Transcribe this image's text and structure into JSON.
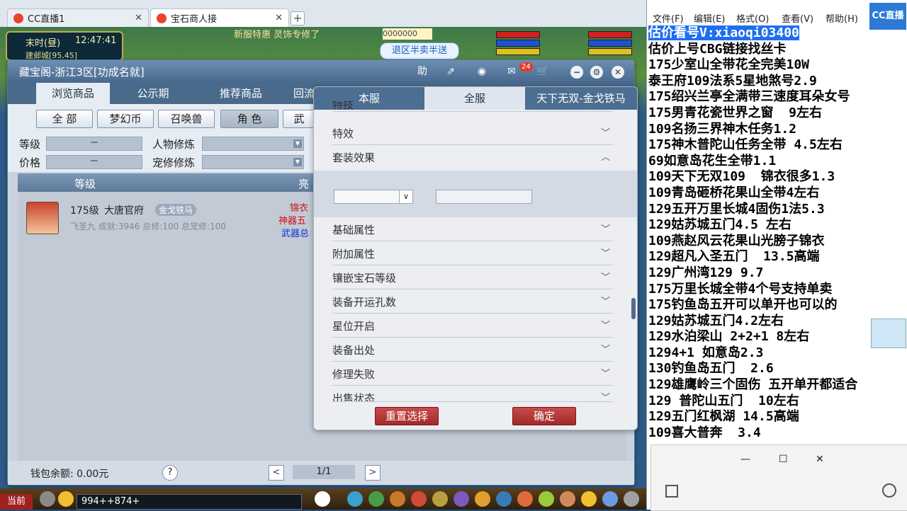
{
  "browser": {
    "tabs": [
      {
        "label": "CC直播1",
        "close": "✕"
      },
      {
        "label": "宝石商人接",
        "close": "✕"
      }
    ],
    "new_tab": "+"
  },
  "game_hud": {
    "time_period": "末时(昼)",
    "clock": "12:47:41",
    "location": "建邺城[95,45]",
    "news": "新服特惠  灵饰专修了",
    "coins": "0000000",
    "notice_button": "退区半卖半送"
  },
  "window": {
    "title": "藏宝阁-浙江3区[功成名就]",
    "title_buttons": {
      "help": "助",
      "share": "⇗",
      "record": "◉",
      "message_badge": "24",
      "cart": "🛒",
      "minimize": "−",
      "settings": "⚙",
      "close": "✕"
    },
    "main_tabs": [
      "浏览商品",
      "公示期",
      "推荐商品",
      "回流"
    ],
    "categories": [
      "全 部",
      "梦幻币",
      "召唤兽",
      "角 色",
      "武"
    ],
    "filters": {
      "level_label": "等级",
      "level_value": "－",
      "price_label": "价格",
      "price_value": "－",
      "role_cult_label": "人物修炼",
      "pet_cult_label": "宠修修炼"
    },
    "list_header": {
      "level": "等级",
      "bright": "亮"
    },
    "item": {
      "level": "175级",
      "school": "大唐官府",
      "tag": "金戈铁马",
      "stats": "飞圣九  成就:3946  总修:100  总宠修:100",
      "highlight1": "锦衣",
      "highlight2": "神器五",
      "highlight3": "武器总"
    },
    "footer": {
      "wallet": "钱包余额: 0.00元",
      "help": "?",
      "prev": "<",
      "page": "1/1",
      "next": ">"
    }
  },
  "panel": {
    "tabs": [
      "本服",
      "全服",
      "天下无双-金戈铁马"
    ],
    "partial_row": "特技",
    "rows": [
      "特效",
      "套装效果",
      "基础属性",
      "附加属性",
      "镶嵌宝石等级",
      "装备开运孔数",
      "星位开启",
      "装备出处",
      "修理失败",
      "出售状态"
    ],
    "chevron_down": "﹀",
    "chevron_up": "︿",
    "select_arrow": "∨",
    "reset_button": "重置选择",
    "confirm_button": "确定"
  },
  "game_bottom": {
    "current_label": "当前",
    "chat_input": "994++874+"
  },
  "notepad": {
    "menu": [
      "文件(F)",
      "编辑(E)",
      "格式(O)",
      "查看(V)",
      "帮助(H)"
    ],
    "lines": [
      "估价看号V:xiaoqi03400",
      "估价上号CBG链接找丝卡",
      "175少室山全带花全完美10W",
      "泰王府109法系5星地煞号2.9",
      "175绍兴兰亭全满带三速度耳朵女号",
      "175男青花瓷世界之窗  9左右",
      "109名扬三界神木任务1.2",
      "175神木普陀山任务全带 4.5左右",
      "69如意岛花生全带1.1",
      "109天下无双109  锦衣很多1.3",
      "109青岛砸桥花果山全带4左右",
      "129五开万里长城4固伤1法5.3",
      "129姑苏城五门4.5 左右",
      "109燕赵风云花果山光膀子锦衣",
      "129超凡入圣五门  13.5高端",
      "129广州湾129 9.7",
      "175万里长城全带4个号支持单卖",
      "175钓鱼岛五开可以单开也可以的",
      "129姑苏城五门4.2左右",
      "129水泊梁山 2+2+1 8左右",
      "1294+1 如意岛2.3",
      "130钓鱼岛五门  2.6",
      "129雄鹰岭三个固伤 五开单开都适合",
      "129 普陀山五门  10左右",
      "129五门红枫湖 14.5高端",
      "109喜大普奔  3.4"
    ],
    "subwindow": {
      "minimize": "—",
      "maximize": "☐",
      "close": "✕"
    },
    "cc_logo": "CC直播"
  },
  "colors": {
    "accent_red": "#a22a2a",
    "title_blue": "#48698e",
    "highlight_blue": "#1e6ff0"
  }
}
